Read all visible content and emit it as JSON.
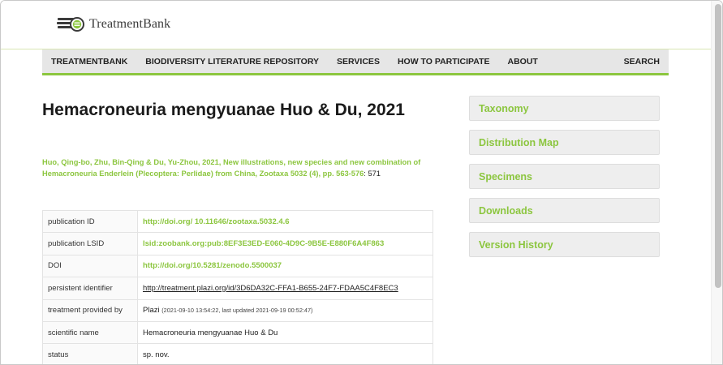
{
  "brand": {
    "name": "TreatmentBank",
    "logo_icon": "treatmentbank-logo-icon",
    "accent": "#8cc63f"
  },
  "nav": {
    "items": [
      "TREATMENTBANK",
      "BIODIVERSITY LITERATURE REPOSITORY",
      "SERVICES",
      "HOW TO PARTICIPATE",
      "ABOUT"
    ],
    "search": "SEARCH"
  },
  "title": "Hemacroneuria mengyuanae Huo & Du, 2021",
  "citation": {
    "link_text": "Huo, Qing-bo, Zhu, Bin-Qing & Du, Yu-Zhou, 2021, New illustrations, new species and new combination of Hemacroneuria Enderlein (Plecoptera: Perlidae) from China, Zootaxa 5032 (4), pp. 563-576",
    "page": ": 571"
  },
  "details": [
    {
      "key": "publication ID",
      "value": "http://doi.org/ 10.11646/zootaxa.5032.4.6"
    },
    {
      "key": "publication LSID",
      "value": "lsid:zoobank.org:pub:8EF3E3ED-E060-4D9C-9B5E-E880F6A4F863"
    },
    {
      "key": "DOI",
      "value": "http://doi.org/10.5281/zenodo.5500037"
    },
    {
      "key": "persistent identifier",
      "value": "http://treatment.plazi.org/id/3D6DA32C-FFA1-B655-24F7-FDAA5C4F8EC3"
    },
    {
      "key": "treatment provided by",
      "value": "Plazi",
      "note": "(2021-09-10 13:54:22, last updated 2021-09-19 00:52:47)"
    },
    {
      "key": "scientific name",
      "value": "Hemacroneuria mengyuanae Huo & Du"
    },
    {
      "key": "status",
      "value": "sp. nov."
    }
  ],
  "sidebar": {
    "buttons": [
      "Taxonomy",
      "Distribution Map",
      "Specimens",
      "Downloads",
      "Version History"
    ]
  }
}
